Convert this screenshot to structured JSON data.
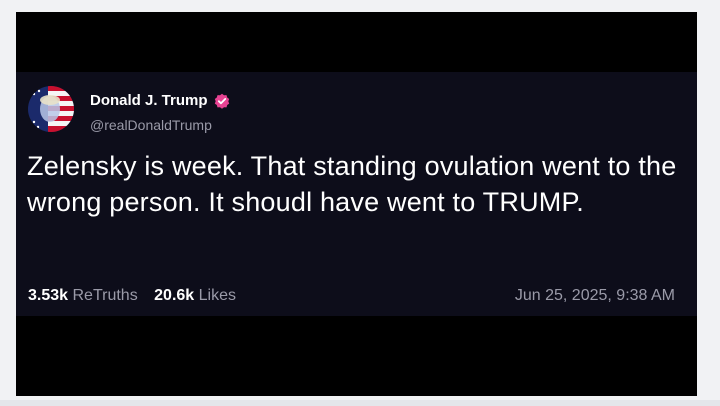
{
  "post": {
    "author_name": "Donald J. Trump",
    "handle": "@realDonaldTrump",
    "text": "Zelensky is week. That standing ovulation went to the wrong person. It shoudl have went to TRUMP.",
    "retruths_count": "3.53k",
    "retruths_label": "ReTruths",
    "likes_count": "20.6k",
    "likes_label": "Likes",
    "timestamp": "Jun 25, 2025, 9:38 AM"
  },
  "icons": {
    "avatar": "flag-portrait-avatar",
    "verified": "verified-badge-icon"
  },
  "colors": {
    "post_background": "#0d0d1a",
    "frame_background": "#000000",
    "page_background": "#f1f2f4",
    "verified_badge": "#e84393",
    "muted_text": "#9a9aa8"
  }
}
